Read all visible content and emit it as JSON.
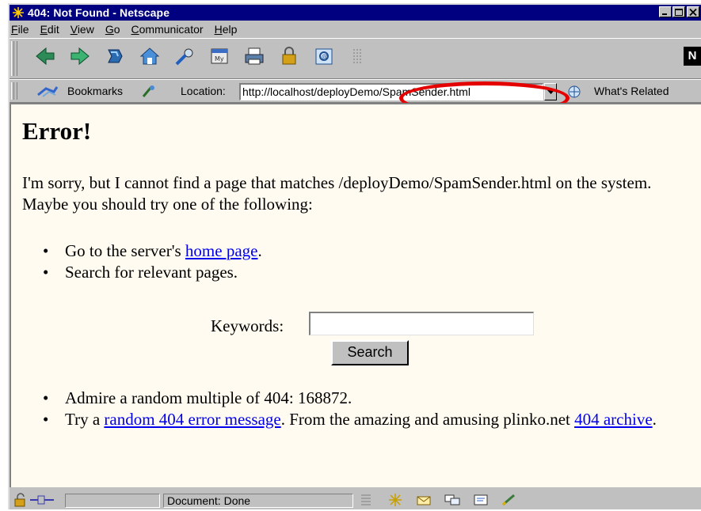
{
  "window": {
    "title": "404: Not Found - Netscape"
  },
  "menu": {
    "items": [
      {
        "underline": "F",
        "rest": "ile"
      },
      {
        "underline": "E",
        "rest": "dit"
      },
      {
        "underline": "V",
        "rest": "iew"
      },
      {
        "underline": "G",
        "rest": "o"
      },
      {
        "underline": "C",
        "rest": "ommunicator"
      },
      {
        "underline": "H",
        "rest": "elp"
      }
    ]
  },
  "navigation_toolbar": {
    "icons": [
      "back-icon",
      "forward-icon",
      "reload-icon",
      "home-icon",
      "search-icon",
      "my-netscape-icon",
      "print-icon",
      "security-icon",
      "shop-icon",
      "stop-icon"
    ],
    "logo": "N"
  },
  "location_toolbar": {
    "bookmarks_label": "Bookmarks",
    "location_label": "Location:",
    "url": "http://localhost/deployDemo/SpamSender.html",
    "whats_related_label": "What's Related",
    "highlight_color": "#e50000"
  },
  "page": {
    "heading": "Error!",
    "message": "I'm sorry, but I cannot find a page that matches /deployDemo/SpamSender.html on the system. Maybe you should try one of the following:",
    "item1_before": "Go to the server's ",
    "item1_link": "home page",
    "item1_after": ".",
    "item2": "Search for relevant pages.",
    "keywords_label": "Keywords:",
    "keywords_value": "",
    "search_button": "Search",
    "item3": "Admire a random multiple of 404: 168872.",
    "item4_before": "Try a ",
    "item4_link": "random 404 error message",
    "item4_middle": ". From the amazing and amusing plinko.net ",
    "item4_link2": "404 archive",
    "item4_after": ".",
    "link_color": "#0000ee",
    "background_color": "#fffbf0"
  },
  "status_bar": {
    "text": "Document: Done"
  }
}
